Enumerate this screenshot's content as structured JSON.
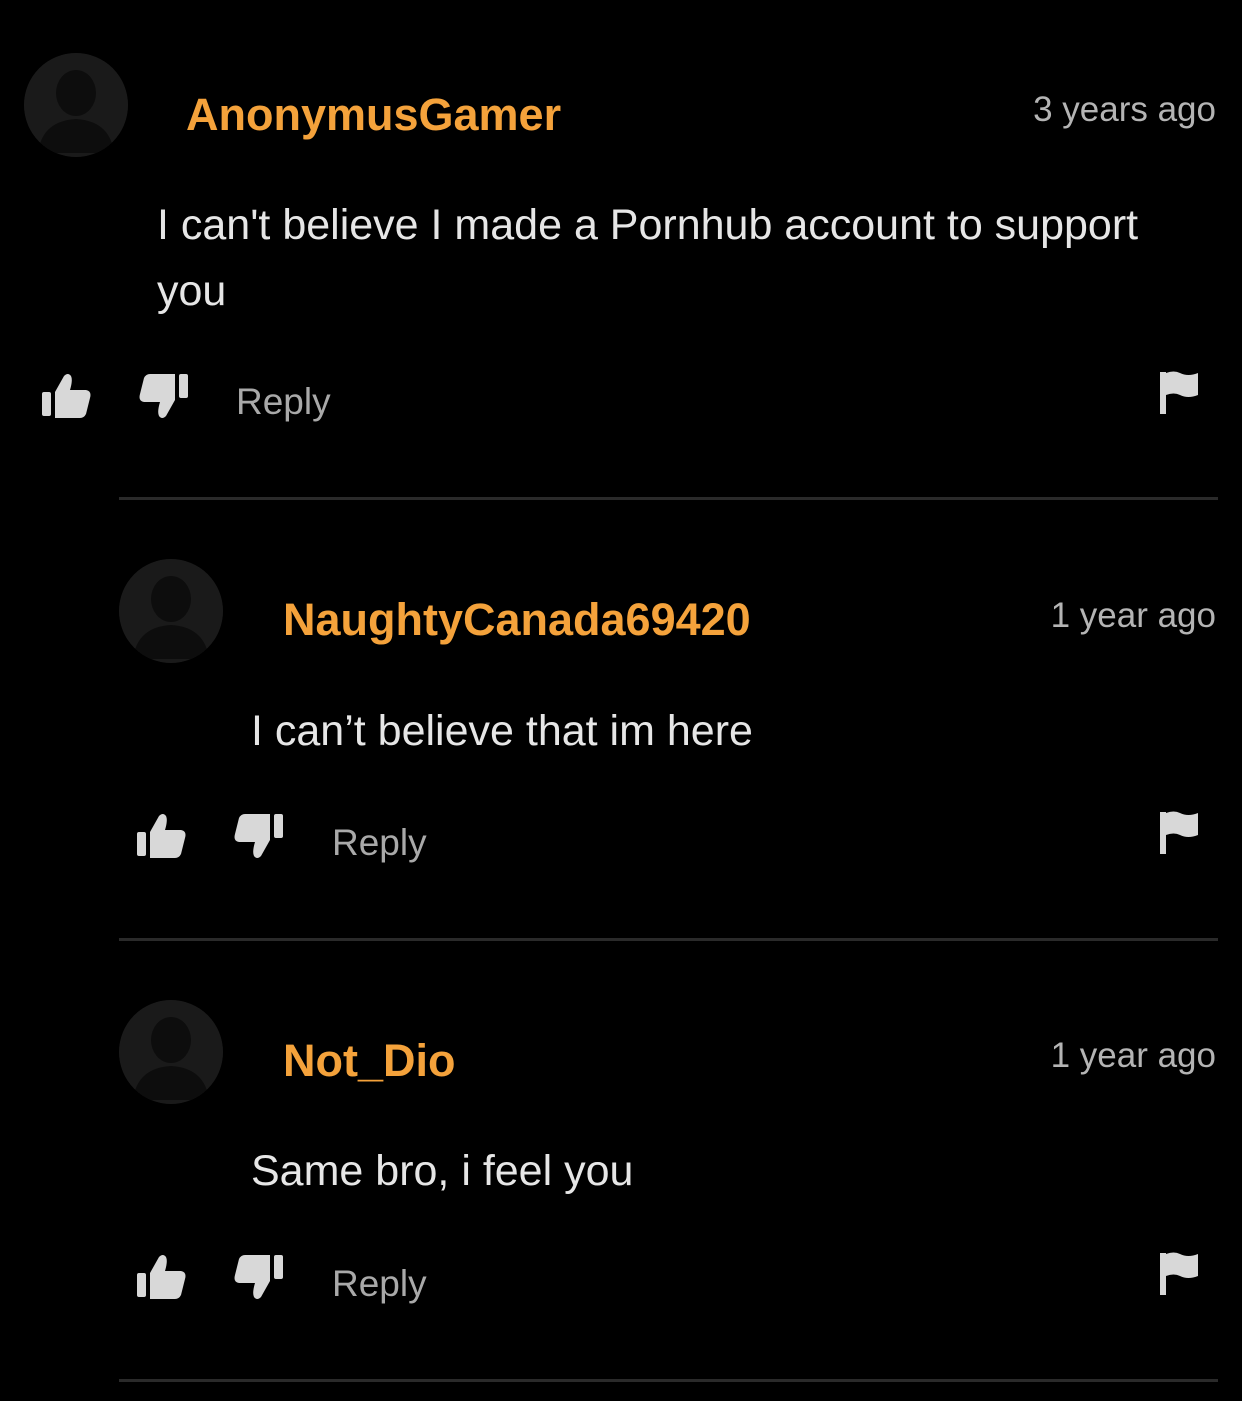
{
  "colors": {
    "background": "#000000",
    "username": "#f4a23b",
    "timestamp": "#b4b4b4",
    "comment_text": "#e6e6e6",
    "reply": "#a9a9a9",
    "icon": "#d8d8d8",
    "divider": "#2a2a2a",
    "avatar": "#1a1a1a"
  },
  "comments": [
    {
      "username": "AnonymusGamer",
      "time": "3 years ago",
      "text": "I can't believe I made a Pornhub account to support you",
      "reply_label": "Reply",
      "avatar_icon": "default-avatar-icon",
      "like_icon": "thumbs-up-icon",
      "dislike_icon": "thumbs-down-icon",
      "flag_icon": "flag-icon"
    },
    {
      "username": "NaughtyCanada69420",
      "time": "1 year ago",
      "text": "I can’t believe that im here",
      "reply_label": "Reply",
      "avatar_icon": "default-avatar-icon",
      "like_icon": "thumbs-up-icon",
      "dislike_icon": "thumbs-down-icon",
      "flag_icon": "flag-icon"
    },
    {
      "username": "Not_Dio",
      "time": "1 year ago",
      "text": "Same bro, i feel you",
      "reply_label": "Reply",
      "avatar_icon": "default-avatar-icon",
      "like_icon": "thumbs-up-icon",
      "dislike_icon": "thumbs-down-icon",
      "flag_icon": "flag-icon"
    }
  ]
}
